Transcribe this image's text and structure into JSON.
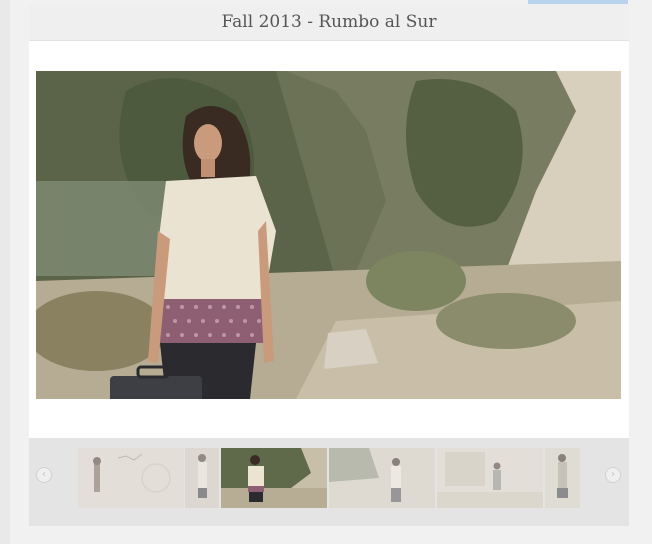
{
  "gallery": {
    "title": "Fall 2013 - Rumbo al Sur",
    "main_image_alt": "Woman in cream and patterned top holding suitcase by roadside",
    "prev_icon": "chevron-left-icon",
    "next_icon": "chevron-right-icon",
    "prev_glyph": "‹",
    "next_glyph": "›",
    "thumbnails": [
      {
        "name": "thumb-1",
        "active": false
      },
      {
        "name": "thumb-2",
        "active": false
      },
      {
        "name": "thumb-3",
        "active": true
      },
      {
        "name": "thumb-4",
        "active": false
      },
      {
        "name": "thumb-5",
        "active": false
      },
      {
        "name": "thumb-6",
        "active": false
      }
    ]
  }
}
